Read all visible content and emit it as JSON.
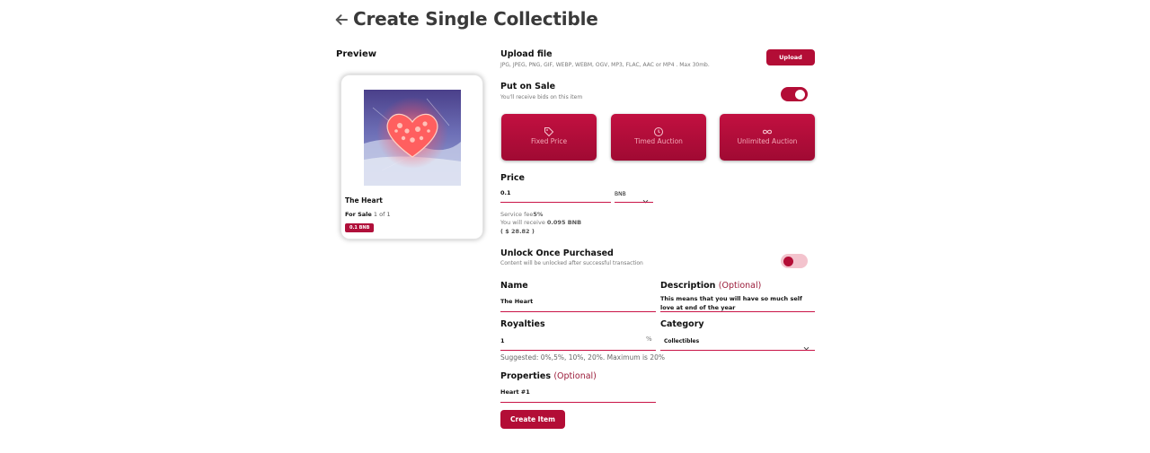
{
  "header": {
    "title": "Create Single Collectible"
  },
  "preview": {
    "label": "Preview",
    "card": {
      "name": "The Heart",
      "sale_label": "For Sale",
      "sale_count": "1 of 1",
      "price_badge": "0.1 BNB"
    }
  },
  "upload": {
    "title": "Upload file",
    "formats": "JPG, JPEG, PNG, GIF, WEBP, WEBM, OGV, MP3, FLAC, AAC or MP4 . Max 30mb.",
    "button_label": "Upload"
  },
  "put_on_sale": {
    "title": "Put on Sale",
    "subtitle": "You'll receive bids on this item",
    "enabled": true
  },
  "sale_types": [
    {
      "label": "Fixed Price",
      "icon": "tag-icon"
    },
    {
      "label": "Timed Auction",
      "icon": "clock-icon"
    },
    {
      "label": "Unlimited Auction",
      "icon": "infinity-icon"
    }
  ],
  "price": {
    "title": "Price",
    "value": "0.1",
    "currency": "BNB",
    "service_fee_label": "Service fee",
    "service_fee_value": "5%",
    "receive_label": "You will receive",
    "receive_value": "0.095 BNB",
    "usd_value": "( $ 28.82 )"
  },
  "unlock": {
    "title": "Unlock Once Purchased",
    "subtitle": "Content will be unlocked after successful transaction",
    "enabled": false
  },
  "name_field": {
    "label": "Name",
    "value": "The Heart"
  },
  "description_field": {
    "label": "Description",
    "optional": "(Optional)",
    "value": "This means that you will have so much self love at end of the year"
  },
  "royalties_field": {
    "label": "Royalties",
    "value": "1",
    "suffix": "%",
    "hint": "Suggested: 0%,5%, 10%, 20%. Maximum is 20%"
  },
  "category_field": {
    "label": "Category",
    "value": "Collectibles"
  },
  "properties_field": {
    "label": "Properties",
    "optional": "(Optional)",
    "value": "Heart #1"
  },
  "actions": {
    "create_label": "Create Item"
  },
  "colors": {
    "accent": "#b30d36",
    "accent_light": "#f3c3cd",
    "line": "#c91447"
  }
}
